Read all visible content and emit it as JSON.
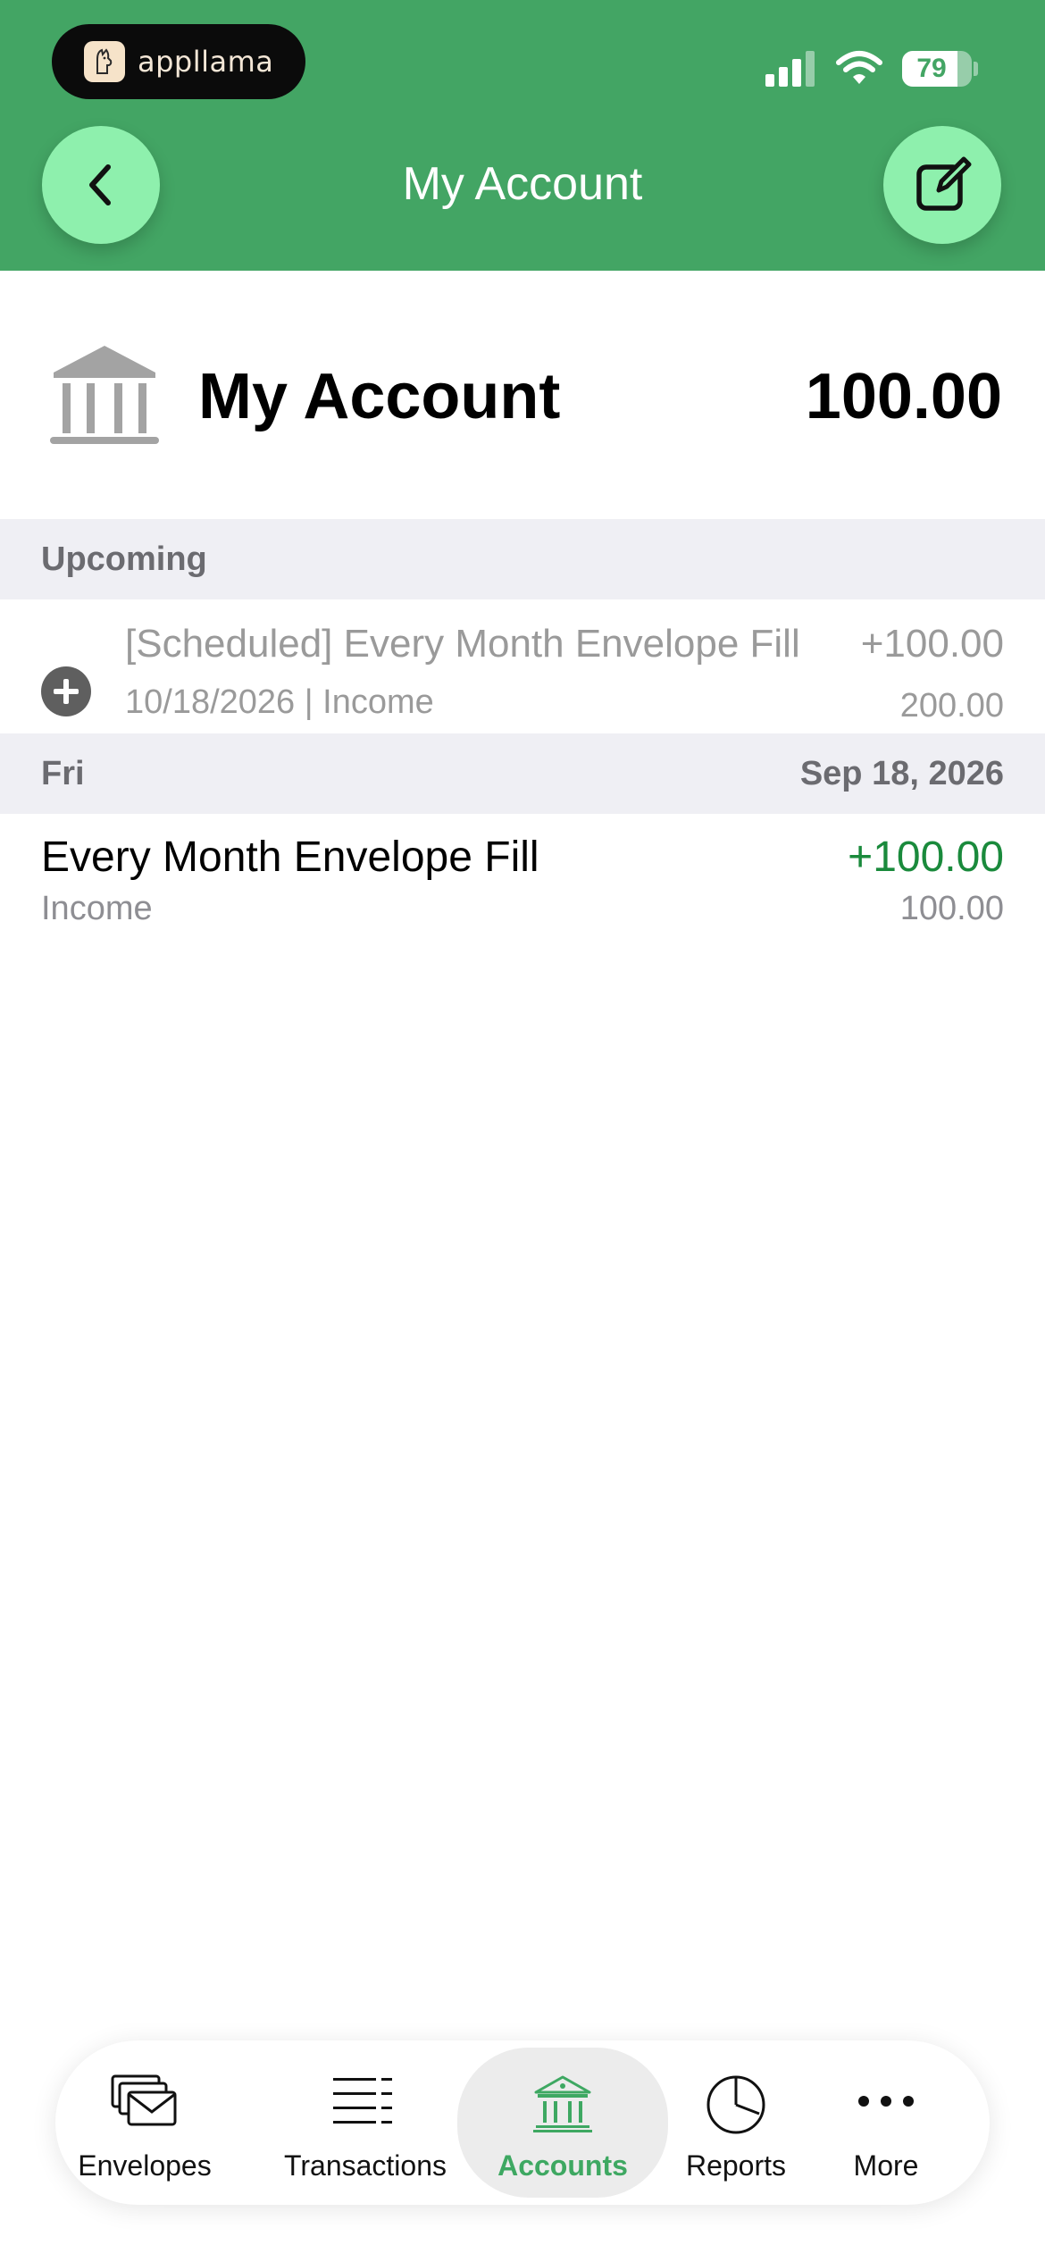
{
  "status_bar": {
    "brand": "appllama",
    "battery": "79",
    "battery_level": 0.79,
    "icons": [
      "signal-icon",
      "wifi-icon",
      "battery-icon"
    ]
  },
  "header": {
    "title": "My Account",
    "back_icon": "chevron-left-icon",
    "edit_icon": "edit-icon",
    "background_color": "#43a564",
    "button_color": "#8ef0ad"
  },
  "account": {
    "icon": "bank-icon",
    "name": "My Account",
    "balance": "100.00"
  },
  "upcoming": {
    "section_label": "Upcoming",
    "item": {
      "icon": "add-circle-icon",
      "title": "[Scheduled] Every Month Envelope Fill",
      "amount": "+100.00",
      "meta": "10/18/2026 | Income",
      "running_balance": "200.00"
    }
  },
  "day_group": {
    "weekday": "Fri",
    "date": "Sep 18, 2026",
    "transactions": [
      {
        "title": "Every Month Envelope Fill",
        "amount": "+100.00",
        "category": "Income",
        "running_balance": "100.00",
        "amount_color": "#1a8a3c"
      }
    ]
  },
  "tab_bar": {
    "tabs": [
      {
        "label": "Envelopes",
        "icon": "envelopes-icon",
        "active": false
      },
      {
        "label": "Transactions",
        "icon": "list-icon",
        "active": false
      },
      {
        "label": "Accounts",
        "icon": "bank-icon",
        "active": true
      },
      {
        "label": "Reports",
        "icon": "pie-chart-icon",
        "active": false
      },
      {
        "label": "More",
        "icon": "more-icon",
        "active": false
      }
    ],
    "active_color": "#3ea862"
  }
}
